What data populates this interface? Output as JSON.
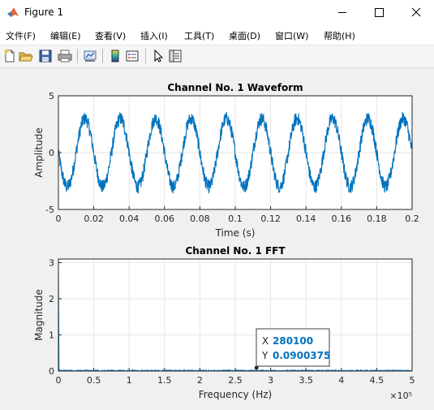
{
  "window": {
    "title": "Figure 1"
  },
  "menu": [
    "文件(F)",
    "编辑(E)",
    "查看(V)",
    "插入(I)",
    "工具(T)",
    "桌面(D)",
    "窗口(W)",
    "帮助(H)"
  ],
  "toolbar": {
    "icons": [
      "new-figure-icon",
      "open-file-icon",
      "save-icon",
      "print-icon",
      "link-plot-icon",
      "insert-colorbar-icon",
      "insert-legend-icon",
      "edit-plot-arrow-icon",
      "property-inspector-icon"
    ]
  },
  "colors": {
    "line": "#0072bd",
    "axes_bg": "#ffffff",
    "figure_bg": "#f0f0f0",
    "grid": "#e6e6e6",
    "datatip": "#0072bd"
  },
  "chart_data": [
    {
      "type": "line",
      "title": "Channel No. 1 Waveform",
      "xlabel": "Time (s)",
      "ylabel": "Amplitude",
      "xlim": [
        0,
        0.2
      ],
      "ylim": [
        -5,
        5
      ],
      "xticks": [
        "0",
        "0.02",
        "0.04",
        "0.06",
        "0.08",
        "0.1",
        "0.12",
        "0.14",
        "0.16",
        "0.18",
        "0.2"
      ],
      "yticks": [
        "-5",
        "0",
        "5"
      ],
      "grid": true,
      "series": [
        {
          "signal": "sine",
          "frequency_hz": 50,
          "amplitude": 3.0,
          "noise_amplitude": 0.6,
          "peak_time_s": 0.015
        }
      ]
    },
    {
      "type": "line",
      "title": "Channel No. 1 FFT",
      "xlabel": "Frequency (Hz)",
      "ylabel": "Magnitude",
      "xlim": [
        0,
        500000
      ],
      "ylim": [
        0,
        3.1
      ],
      "xticks": [
        "0",
        "0.5",
        "1",
        "1.5",
        "2",
        "2.5",
        "3",
        "3.5",
        "4",
        "4.5",
        "5"
      ],
      "x_multiplier": "×10⁵",
      "yticks": [
        "0",
        "1",
        "2",
        "3"
      ],
      "grid": true,
      "series": [
        {
          "peaks": [
            {
              "x": 0,
              "y": 3.0
            },
            {
              "x": 280100,
              "y": 0.0900375
            }
          ],
          "noise_floor": 0.03
        }
      ],
      "datatip": {
        "x_label": "X",
        "x": "280100",
        "y_label": "Y",
        "y": "0.0900375"
      }
    }
  ]
}
